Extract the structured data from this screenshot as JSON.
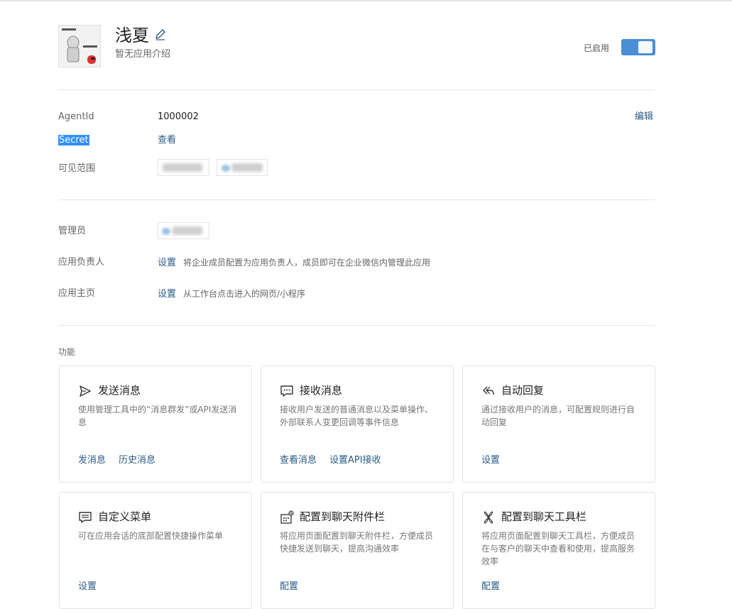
{
  "app": {
    "name": "浅夏",
    "description": "暂无应用介绍",
    "status_label": "已启用",
    "toggle_on": true,
    "accent_color": "#4a8fd6",
    "link_color": "#2b5b87"
  },
  "info": {
    "agentid_label": "AgentId",
    "agentid_value": "1000002",
    "edit_label": "编辑",
    "secret_label": "Secret",
    "secret_action": "查看",
    "visibility_label": "可见范围"
  },
  "admin": {
    "admin_label": "管理员",
    "owner_label": "应用负责人",
    "owner_action": "设置",
    "owner_hint": "将企业成员配置为应用负责人，成员即可在企业微信内管理此应用",
    "homepage_label": "应用主页",
    "homepage_action": "设置",
    "homepage_hint": "从工作台点击进入的网页/小程序"
  },
  "features": {
    "section_title": "功能",
    "cards": [
      {
        "icon": "send-icon",
        "title": "发送消息",
        "desc": "使用管理工具中的“消息群发”或API发送消息",
        "links": [
          "发消息",
          "历史消息"
        ]
      },
      {
        "icon": "chat-bubble-icon",
        "title": "接收消息",
        "desc": "接收用户发送的普通消息以及菜单操作、外部联系人变更回调等事件信息",
        "links": [
          "查看消息",
          "设置API接收"
        ]
      },
      {
        "icon": "reply-icon",
        "title": "自动回复",
        "desc": "通过接收用户的消息，可配置规则进行自动回复",
        "links": [
          "设置"
        ]
      },
      {
        "icon": "menu-icon",
        "title": "自定义菜单",
        "desc": "可在应用会话的底部配置快捷操作菜单",
        "links": [
          "设置"
        ]
      },
      {
        "icon": "attachment-bar-icon",
        "title": "配置到聊天附件栏",
        "desc": "将应用页面配置到聊天附件栏，方便成员快捷发送到聊天，提高沟通效率",
        "links": [
          "配置"
        ]
      },
      {
        "icon": "toolbar-icon",
        "title": "配置到聊天工具栏",
        "desc": "将应用页面配置到聊天工具栏，方便成员在与客户的聊天中查看和使用，提高服务效率",
        "links": [
          "配置"
        ]
      }
    ]
  }
}
